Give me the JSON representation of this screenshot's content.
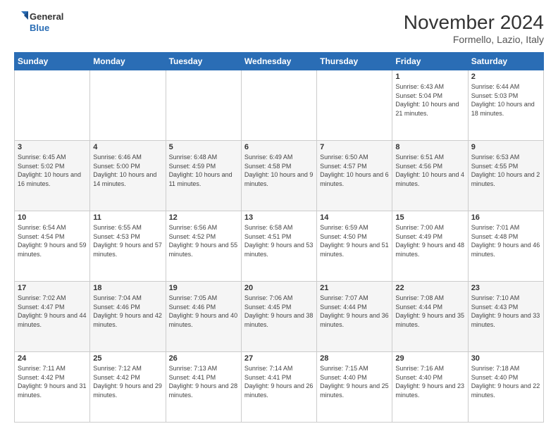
{
  "header": {
    "logo_line1": "General",
    "logo_line2": "Blue",
    "month": "November 2024",
    "location": "Formello, Lazio, Italy"
  },
  "weekdays": [
    "Sunday",
    "Monday",
    "Tuesday",
    "Wednesday",
    "Thursday",
    "Friday",
    "Saturday"
  ],
  "weeks": [
    [
      null,
      null,
      null,
      null,
      null,
      {
        "day": 1,
        "sunrise": "6:43 AM",
        "sunset": "5:04 PM",
        "daylight": "10 hours and 21 minutes."
      },
      {
        "day": 2,
        "sunrise": "6:44 AM",
        "sunset": "5:03 PM",
        "daylight": "10 hours and 18 minutes."
      }
    ],
    [
      {
        "day": 3,
        "sunrise": "6:45 AM",
        "sunset": "5:02 PM",
        "daylight": "10 hours and 16 minutes."
      },
      {
        "day": 4,
        "sunrise": "6:46 AM",
        "sunset": "5:00 PM",
        "daylight": "10 hours and 14 minutes."
      },
      {
        "day": 5,
        "sunrise": "6:48 AM",
        "sunset": "4:59 PM",
        "daylight": "10 hours and 11 minutes."
      },
      {
        "day": 6,
        "sunrise": "6:49 AM",
        "sunset": "4:58 PM",
        "daylight": "10 hours and 9 minutes."
      },
      {
        "day": 7,
        "sunrise": "6:50 AM",
        "sunset": "4:57 PM",
        "daylight": "10 hours and 6 minutes."
      },
      {
        "day": 8,
        "sunrise": "6:51 AM",
        "sunset": "4:56 PM",
        "daylight": "10 hours and 4 minutes."
      },
      {
        "day": 9,
        "sunrise": "6:53 AM",
        "sunset": "4:55 PM",
        "daylight": "10 hours and 2 minutes."
      }
    ],
    [
      {
        "day": 10,
        "sunrise": "6:54 AM",
        "sunset": "4:54 PM",
        "daylight": "9 hours and 59 minutes."
      },
      {
        "day": 11,
        "sunrise": "6:55 AM",
        "sunset": "4:53 PM",
        "daylight": "9 hours and 57 minutes."
      },
      {
        "day": 12,
        "sunrise": "6:56 AM",
        "sunset": "4:52 PM",
        "daylight": "9 hours and 55 minutes."
      },
      {
        "day": 13,
        "sunrise": "6:58 AM",
        "sunset": "4:51 PM",
        "daylight": "9 hours and 53 minutes."
      },
      {
        "day": 14,
        "sunrise": "6:59 AM",
        "sunset": "4:50 PM",
        "daylight": "9 hours and 51 minutes."
      },
      {
        "day": 15,
        "sunrise": "7:00 AM",
        "sunset": "4:49 PM",
        "daylight": "9 hours and 48 minutes."
      },
      {
        "day": 16,
        "sunrise": "7:01 AM",
        "sunset": "4:48 PM",
        "daylight": "9 hours and 46 minutes."
      }
    ],
    [
      {
        "day": 17,
        "sunrise": "7:02 AM",
        "sunset": "4:47 PM",
        "daylight": "9 hours and 44 minutes."
      },
      {
        "day": 18,
        "sunrise": "7:04 AM",
        "sunset": "4:46 PM",
        "daylight": "9 hours and 42 minutes."
      },
      {
        "day": 19,
        "sunrise": "7:05 AM",
        "sunset": "4:46 PM",
        "daylight": "9 hours and 40 minutes."
      },
      {
        "day": 20,
        "sunrise": "7:06 AM",
        "sunset": "4:45 PM",
        "daylight": "9 hours and 38 minutes."
      },
      {
        "day": 21,
        "sunrise": "7:07 AM",
        "sunset": "4:44 PM",
        "daylight": "9 hours and 36 minutes."
      },
      {
        "day": 22,
        "sunrise": "7:08 AM",
        "sunset": "4:44 PM",
        "daylight": "9 hours and 35 minutes."
      },
      {
        "day": 23,
        "sunrise": "7:10 AM",
        "sunset": "4:43 PM",
        "daylight": "9 hours and 33 minutes."
      }
    ],
    [
      {
        "day": 24,
        "sunrise": "7:11 AM",
        "sunset": "4:42 PM",
        "daylight": "9 hours and 31 minutes."
      },
      {
        "day": 25,
        "sunrise": "7:12 AM",
        "sunset": "4:42 PM",
        "daylight": "9 hours and 29 minutes."
      },
      {
        "day": 26,
        "sunrise": "7:13 AM",
        "sunset": "4:41 PM",
        "daylight": "9 hours and 28 minutes."
      },
      {
        "day": 27,
        "sunrise": "7:14 AM",
        "sunset": "4:41 PM",
        "daylight": "9 hours and 26 minutes."
      },
      {
        "day": 28,
        "sunrise": "7:15 AM",
        "sunset": "4:40 PM",
        "daylight": "9 hours and 25 minutes."
      },
      {
        "day": 29,
        "sunrise": "7:16 AM",
        "sunset": "4:40 PM",
        "daylight": "9 hours and 23 minutes."
      },
      {
        "day": 30,
        "sunrise": "7:18 AM",
        "sunset": "4:40 PM",
        "daylight": "9 hours and 22 minutes."
      }
    ]
  ]
}
